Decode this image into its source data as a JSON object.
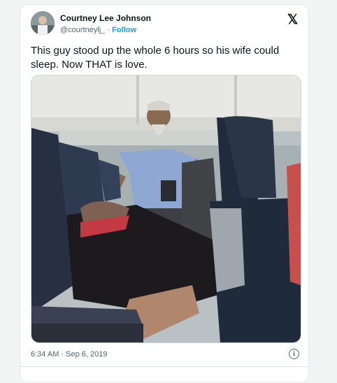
{
  "tweet": {
    "author_name": "Courtney Lee Johnson",
    "handle": "@courtneylj_",
    "separator": "·",
    "follow_label": "Follow",
    "platform_logo": "𝕏",
    "text": "This guy stood up the whole 6 hours so his wife could sleep. Now THAT is love.",
    "timestamp": "6:34 AM · Sep 6, 2019",
    "info_glyph": "i"
  },
  "icons": {
    "platform": "x-logo-icon",
    "info": "info-icon"
  },
  "colors": {
    "accent": "#1d9bf0",
    "text_primary": "#0f1419",
    "text_secondary": "#536471",
    "border": "#e1e8ed"
  }
}
